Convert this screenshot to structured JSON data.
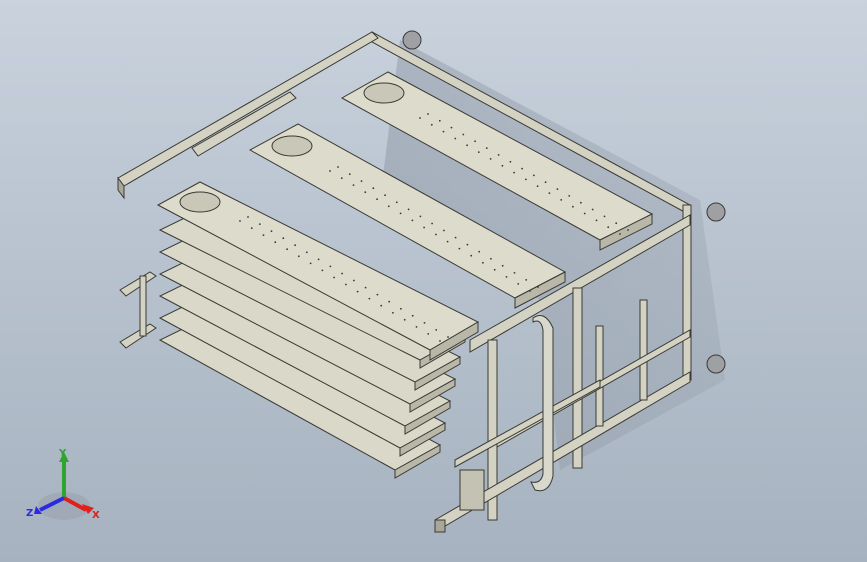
{
  "viewport": {
    "background_top": "#c9d2dd",
    "background_bottom": "#a7b2c0"
  },
  "model": {
    "frame_color": "#d4d3c3",
    "frame_edge": "#3a3a34",
    "plate_color": "#d9d8c9",
    "plate_side": "#b9b8a8",
    "pipe_color": "#d8d8cc"
  },
  "triad": {
    "x_label": "X",
    "y_label": "Y",
    "z_label": "Z",
    "x_color": "#e0201a",
    "y_color": "#2fa52f",
    "z_color": "#2a2ae0"
  }
}
